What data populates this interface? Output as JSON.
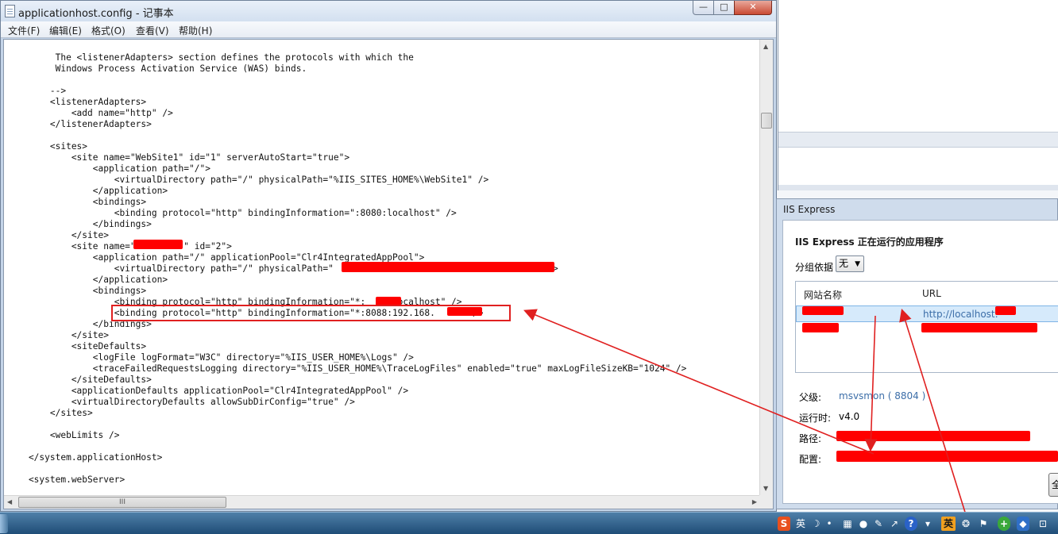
{
  "notepad": {
    "title": "applicationhost.config - 记事本",
    "buttons": {
      "minimize": "—",
      "maximize": "□",
      "close": "✕"
    },
    "menu": [
      "文件(F)",
      "编辑(E)",
      "格式(O)",
      "查看(V)",
      "帮助(H)"
    ],
    "lines": [
      "         The <listenerAdapters> section defines the protocols with which the",
      "         Windows Process Activation Service (WAS) binds.",
      "",
      "        -->",
      "        <listenerAdapters>",
      "            <add name=\"http\" />",
      "        </listenerAdapters>",
      "",
      "        <sites>",
      "            <site name=\"WebSite1\" id=\"1\" serverAutoStart=\"true\">",
      "                <application path=\"/\">",
      "                    <virtualDirectory path=\"/\" physicalPath=\"%IIS_SITES_HOME%\\WebSite1\" />",
      "                </application>",
      "                <bindings>",
      "                    <binding protocol=\"http\" bindingInformation=\":8080:localhost\" />",
      "                </bindings>",
      "            </site>",
      "            <site name=\"         \" id=\"2\">",
      "                <application path=\"/\" applicationPool=\"Clr4IntegratedAppPool\">",
      "                    <virtualDirectory path=\"/\" physicalPath=\"                                      \" />",
      "                </application>",
      "                <bindings>",
      "                    <binding protocol=\"http\" bindingInformation=\"*:    :localhost\" />",
      "                    <binding protocol=\"http\" bindingInformation=\"*:8088:192.168.     \" />",
      "                </bindings>",
      "            </site>",
      "            <siteDefaults>",
      "                <logFile logFormat=\"W3C\" directory=\"%IIS_USER_HOME%\\Logs\" />",
      "                <traceFailedRequestsLogging directory=\"%IIS_USER_HOME%\\TraceLogFiles\" enabled=\"true\" maxLogFileSizeKB=\"1024\" />",
      "            </siteDefaults>",
      "            <applicationDefaults applicationPool=\"Clr4IntegratedAppPool\" />",
      "            <virtualDirectoryDefaults allowSubDirConfig=\"true\" />",
      "        </sites>",
      "",
      "        <webLimits />",
      "",
      "    </system.applicationHost>",
      "",
      "    <system.webServer>"
    ],
    "hscroll_grip": "III"
  },
  "iis": {
    "title": "IIS Express",
    "heading": "IIS Express 正在运行的应用程序",
    "group_label": "分组依据",
    "group_value": "无",
    "columns": {
      "name": "网站名称",
      "url": "URL"
    },
    "rows": [
      {
        "url": "http://localhost:"
      },
      {
        "url": ""
      }
    ],
    "details": {
      "parent_label": "父级:",
      "parent_value": "msvsmon ( 8804 )",
      "runtime_label": "运行时:",
      "runtime_value": "v4.0",
      "path_label": "路径:",
      "config_label": "配置:"
    },
    "right_button": "全"
  },
  "taskbar": {
    "tray_sogou": "S",
    "tray_lang": "英",
    "tray_moon": "☽",
    "tray_dot": "•",
    "tray_keyboard": "▦",
    "tray_user": "●",
    "tray_wrench": "✎",
    "tray_share": "↗",
    "tray_help": "?",
    "tray_hide": "▾",
    "tray_en": "英",
    "tray_gear": "❂",
    "tray_flag": "⚑",
    "tray_plus": "+",
    "tray_shield": "◆",
    "tray_more": "⊡"
  },
  "colors": {
    "annotation": "#e02020",
    "redaction": "#ff0000",
    "link": "#3c6ea8"
  }
}
